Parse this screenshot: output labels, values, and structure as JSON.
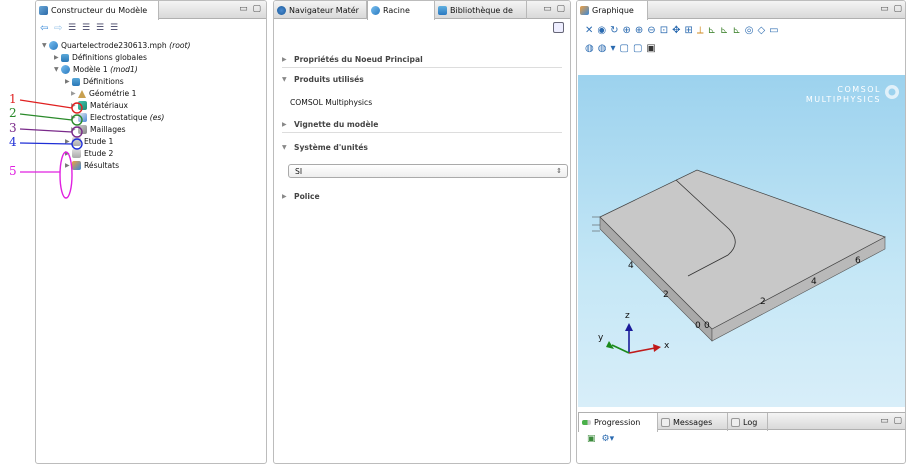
{
  "model_builder": {
    "tab_title": "Constructeur du Modèle",
    "root_name": "Quartelectrode230613.mph",
    "root_tag": "(root)",
    "global_defs": "Définitions globales",
    "model_name": "Modèle 1",
    "model_tag": "(mod1)",
    "definitions": "Définitions",
    "geometry": "Géométrie 1",
    "materials": "Matériaux",
    "electrostatics": "Electrostatique",
    "electrostatics_tag": "(es)",
    "mesh": "Maillages",
    "study1": "Etude 1",
    "study2": "Etude 2",
    "results": "Résultats"
  },
  "annotations": [
    {
      "label": "1",
      "color": "#e02020"
    },
    {
      "label": "2",
      "color": "#2a8a2a"
    },
    {
      "label": "3",
      "color": "#7a2a8a"
    },
    {
      "label": "4",
      "color": "#1f2fd6"
    },
    {
      "label": "5",
      "color": "#e020e0"
    }
  ],
  "middle": {
    "tab1": "Navigateur Matér",
    "tab2": "Racine",
    "tab3": "Bibliothèque de",
    "sec_props": "Propriétés du Noeud Principal",
    "sec_products": "Produits utilisés",
    "product": "COMSOL Multiphysics",
    "sec_thumb": "Vignette du modèle",
    "sec_units": "Système d'unités",
    "units_value": "SI",
    "sec_font": "Police"
  },
  "graphics": {
    "tab_title": "Graphique",
    "logo_line1": "COMSOL",
    "logo_line2": "MULTIPHYSICS",
    "axis_z": "z",
    "axis_y": "y",
    "axis_x": "x",
    "ticks": {
      "y4": "4",
      "y2": "2",
      "y0": "0",
      "x0": "0",
      "x2": "2",
      "x4": "4",
      "x6": "6"
    }
  },
  "bottom": {
    "tab_progress": "Progression",
    "tab_messages": "Messages",
    "tab_log": "Log"
  },
  "colors": {
    "viewport_top": "#9cd2ee",
    "viewport_bottom": "#d8eef9",
    "block_top": "#c8c8c8",
    "block_side": "#a9a9a9"
  }
}
